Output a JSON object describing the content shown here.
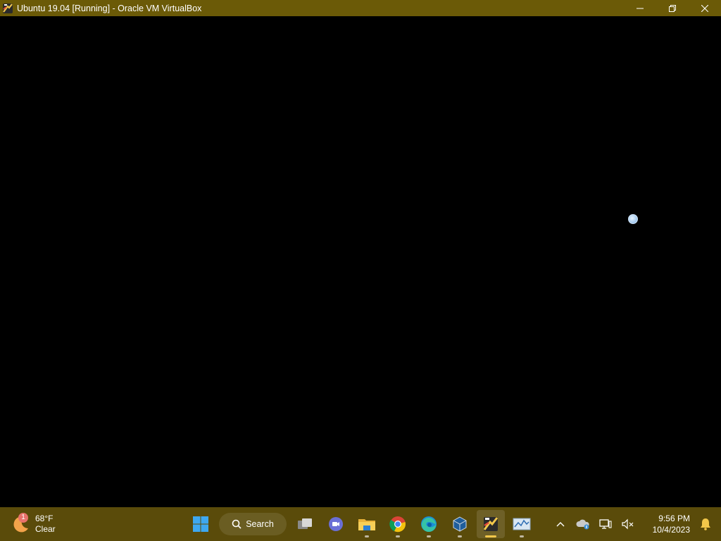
{
  "window": {
    "title": "Ubuntu 19.04 [Running] - Oracle VM VirtualBox",
    "controls": [
      "minimize",
      "restore",
      "close"
    ]
  },
  "taskbar": {
    "weather": {
      "badge": "1",
      "temp": "68°F",
      "condition": "Clear"
    },
    "search_label": "Search",
    "apps": [
      {
        "name": "task-view-icon"
      },
      {
        "name": "teams-chat-icon"
      },
      {
        "name": "file-explorer-icon",
        "running": true
      },
      {
        "name": "chrome-icon",
        "running": true
      },
      {
        "name": "edge-icon",
        "running": true
      },
      {
        "name": "virtualbox-icon",
        "running": true
      },
      {
        "name": "virtualbox-vm-icon",
        "running": true,
        "active": true
      },
      {
        "name": "resource-monitor-icon",
        "running": true
      }
    ],
    "clock": {
      "time": "9:56 PM",
      "date": "10/4/2023"
    }
  },
  "colors": {
    "titlebar": "#6b5a07",
    "taskbar": "#5a4b0a",
    "vm_screen": "#000000"
  }
}
